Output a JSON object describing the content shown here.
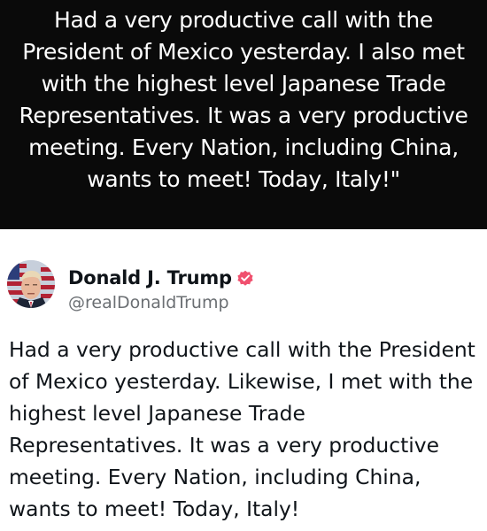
{
  "caption": {
    "text": "Had a very productive call with the President of Mexico yesterday. I also met with the highest level Japanese Trade Representatives. It was a very productive meeting. Every Nation, including China, wants to meet! Today, Italy!\""
  },
  "post": {
    "author": {
      "display_name": "Donald J. Trump",
      "handle": "@realDonaldTrump",
      "verified_badge_color": "#f0506e",
      "avatar_icon": "profile-photo-avatar"
    },
    "body": "Had a very productive call with the President of Mexico yesterday. Likewise, I met with the highest level Japanese Trade Representatives. It was a very productive meeting. Every Nation, including China, wants to meet! Today, Italy!"
  },
  "colors": {
    "banner_background": "#0a0a0a",
    "banner_text": "#ffffff",
    "post_background": "#ffffff",
    "post_text": "#0f1419",
    "handle_text": "#6b6f73"
  }
}
